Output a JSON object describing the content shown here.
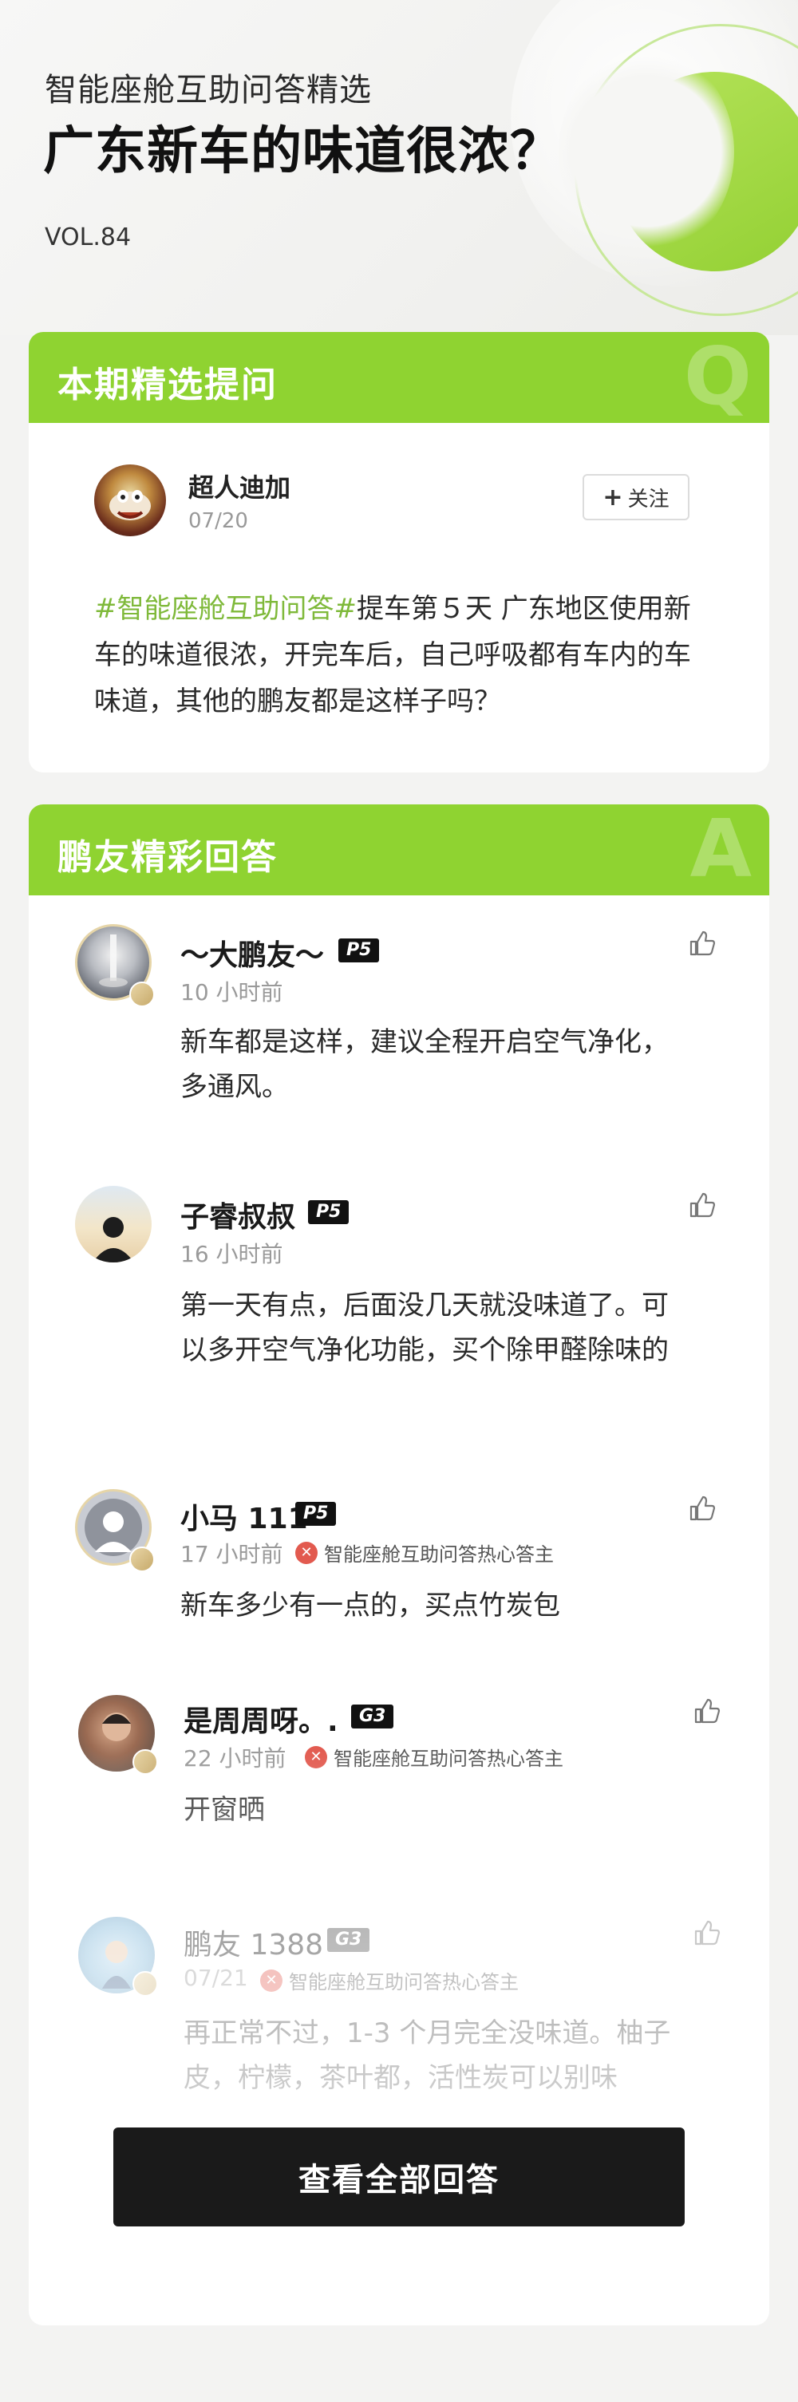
{
  "header": {
    "subtitle": "智能座舱互助问答精选",
    "title": "广东新车的味道很浓？",
    "volume": "VOL.84"
  },
  "question_section": {
    "heading": "本期精选提问",
    "mark": "Q",
    "author": {
      "name": "超人迪加",
      "date": "07/20",
      "avatar_icon": "avatar-image"
    },
    "follow_label": "关注",
    "hashtag": "#智能座舱互助问答#",
    "body": "提车第５天 广东地区使用新车的味道很浓，开完车后，自己呼吸都有车内的车味道，其他的鹏友都是这样子吗？"
  },
  "answers_section": {
    "heading": "鹏友精彩回答",
    "mark": "A",
    "answers": [
      {
        "name": "～大鹏友～",
        "level": "P5",
        "time": "10 小时前",
        "hot_label": "",
        "text": "新车都是这样，建议全程开启空气净化，多通风。"
      },
      {
        "name": "子睿叔叔",
        "level": "P5",
        "time": "16 小时前",
        "hot_label": "",
        "text": "第一天有点，后面没几天就没味道了。可以多开空气净化功能，买个除甲醛除味的"
      },
      {
        "name": "小马 111",
        "level": "P5",
        "time": "17 小时前",
        "hot_label": "智能座舱互助问答热心答主",
        "text": "新车多少有一点的，买点竹炭包"
      },
      {
        "name": "是周周呀。.",
        "level": "G3",
        "time": "22 小时前",
        "hot_label": "智能座舱互助问答热心答主",
        "text": "开窗晒"
      },
      {
        "name": "鹏友 1388",
        "level": "G3",
        "time": "07/21",
        "hot_label": "智能座舱互助问答热心答主",
        "text": "再正常不过，1-3 个月完全没味道。柚子皮，柠檬，茶叶都，活性炭可以别味"
      }
    ],
    "view_all_label": "查看全部回答"
  },
  "colors": {
    "accent": "#8fd331",
    "hashtag": "#7fb93a",
    "badge_bg": "#111111",
    "hot_dot": "#e25a4f"
  }
}
